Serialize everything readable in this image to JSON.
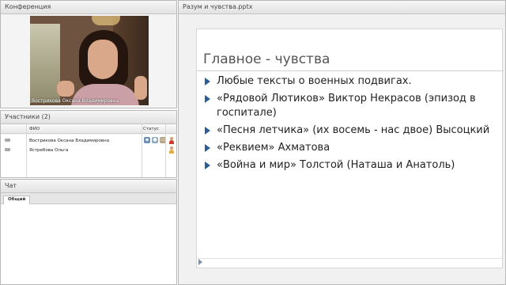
{
  "conference": {
    "title": "Конференция",
    "video_label": "Вострикова Оксана Владимировна"
  },
  "participants": {
    "title": "Участники (2)",
    "columns": {
      "fio": "ФИО",
      "status": "Статус"
    },
    "rows": [
      {
        "name": "Вострикова Оксана Владимировна",
        "status_icons": [
          "camera-icon",
          "microphone-icon",
          "screen-icon"
        ],
        "role_color": "#d03a2a"
      },
      {
        "name": "Ястребова Ольга",
        "status_icons": [],
        "role_color": "#e0b040"
      }
    ]
  },
  "chat": {
    "title": "Чат",
    "tab_general": "Общий"
  },
  "presentation": {
    "title": "Разум и чувства.pptx",
    "slide": {
      "heading": "Главное - чувства",
      "bullets": [
        "Любые тексты о военных подвигах.",
        "«Рядовой Лютиков» Виктор Некрасов (эпизод в госпитале)",
        "«Песня летчика» (их восемь - нас двое) Высоцкий",
        "«Реквием» Ахматова",
        " «Война и мир» Толстой (Наташа и Анатоль)"
      ]
    }
  },
  "colors": {
    "bullet": "#2c5e96",
    "panel_bg": "#f4f4f4"
  }
}
